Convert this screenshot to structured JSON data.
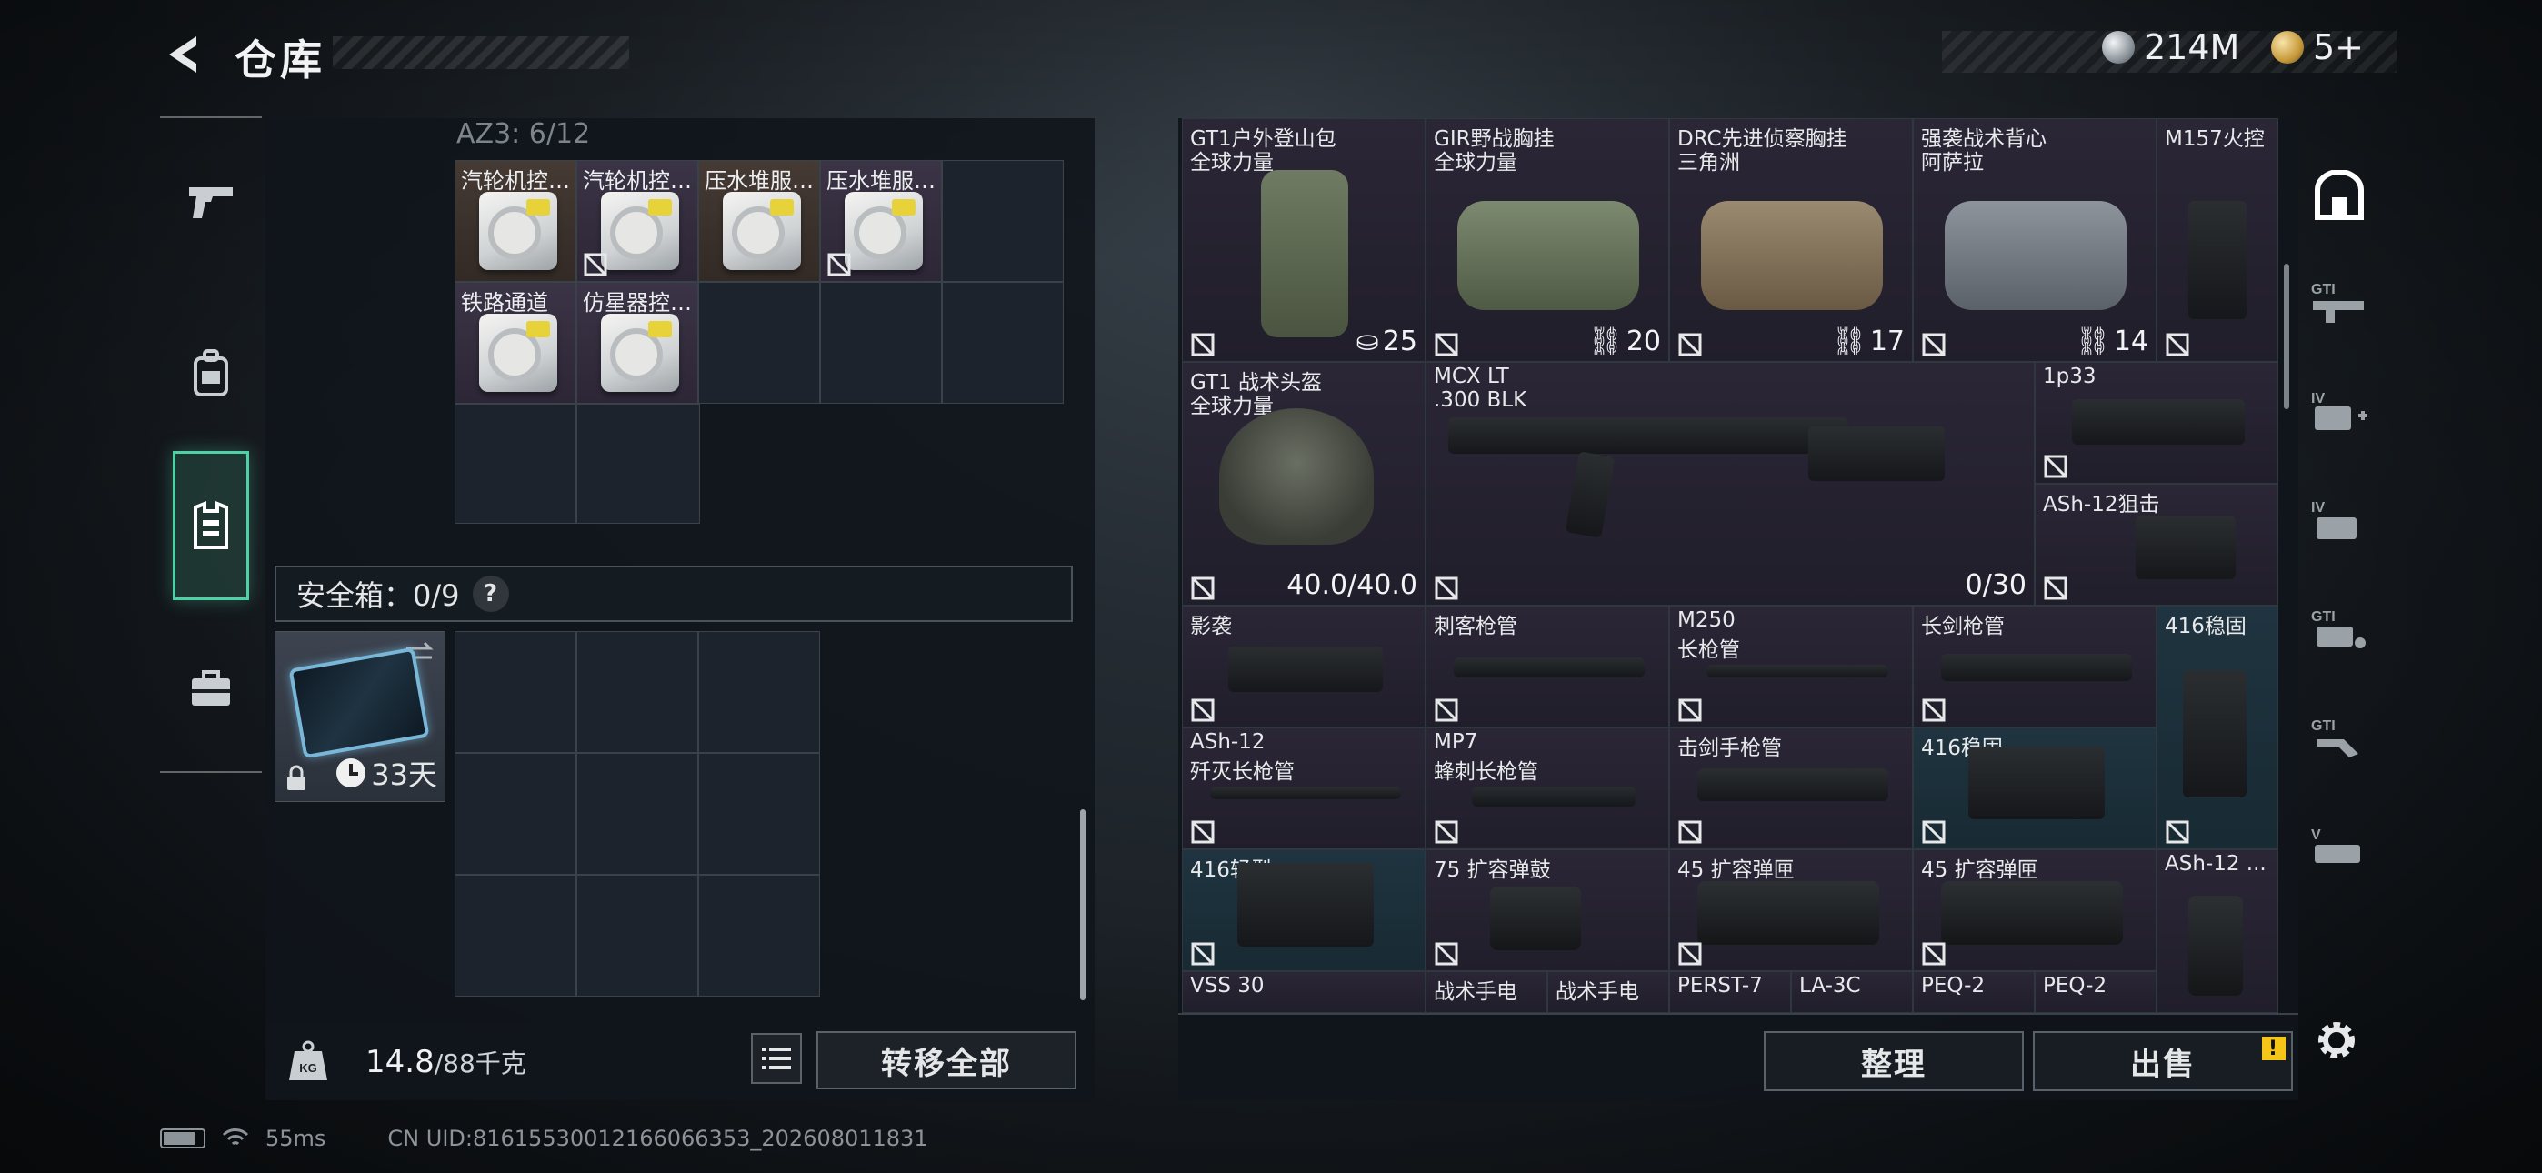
{
  "header": {
    "title": "仓库",
    "currency_silver": "214M",
    "currency_gold": "5+"
  },
  "left_rail": {
    "items": [
      {
        "name": "pistol-icon",
        "active": false
      },
      {
        "name": "backpack-icon",
        "active": false
      },
      {
        "name": "vest-icon",
        "active": true
      },
      {
        "name": "case-icon",
        "active": false
      }
    ]
  },
  "storage": {
    "section_label": "AZ3: 6/12",
    "items": [
      {
        "label": "汽轮机控…",
        "no_sell": false,
        "brown": true
      },
      {
        "label": "汽轮机控…",
        "no_sell": true,
        "brown": false
      },
      {
        "label": "压水堆服…",
        "no_sell": false,
        "brown": true
      },
      {
        "label": "压水堆服…",
        "no_sell": true,
        "brown": false
      },
      {
        "label": "铁路通道",
        "no_sell": false,
        "brown": false
      },
      {
        "label": "仿星器控…",
        "no_sell": false,
        "brown": false
      }
    ]
  },
  "safe_box": {
    "label": "安全箱：0/9",
    "help": "?",
    "days": "33天"
  },
  "weight": {
    "current": "14.8",
    "max": "/88千克"
  },
  "buttons": {
    "transfer_all": "转移全部",
    "organize": "整理",
    "sell": "出售",
    "sell_badge": "!"
  },
  "inventory": {
    "items": [
      {
        "n1": "GT1户外登山包",
        "n2": "全球力量",
        "stat": "25",
        "stat_icon": "capacity",
        "art": "bag-olive"
      },
      {
        "n1": "GIR野战胸挂",
        "n2": "全球力量",
        "stat": "20",
        "stat_icon": "durability",
        "art": "bag-green"
      },
      {
        "n1": "DRC先进侦察胸挂",
        "n2": "三角洲",
        "stat": "17",
        "stat_icon": "durability",
        "art": "bag-tan"
      },
      {
        "n1": "强袭战术背心",
        "n2": "阿萨拉",
        "stat": "14",
        "stat_icon": "durability",
        "art": "bag-grey"
      },
      {
        "n1": "M157火控",
        "n2": "",
        "stat": "",
        "art": "scope"
      },
      {
        "n1": "GT1 战术头盔",
        "n2": "全球力量",
        "stat": "40.0/40.0",
        "art": "helmet"
      },
      {
        "n1": "MCX LT",
        "n2": ".300 BLK",
        "stat": "0/30",
        "art": "rifle"
      },
      {
        "n1": "1p33",
        "n2": "",
        "stat": "",
        "art": "scope"
      },
      {
        "n1": "ASh-12狙击",
        "n2": "",
        "stat": "",
        "art": "stock"
      },
      {
        "n1": "影袭",
        "n2": "",
        "art": "stock"
      },
      {
        "n1": "刺客枪管",
        "n2": "",
        "art": "barrel"
      },
      {
        "n1": "M250",
        "n2": "长枪管",
        "art": "barrel"
      },
      {
        "n1": "长剑枪管",
        "n2": "",
        "art": "barrel"
      },
      {
        "n1": "416稳固",
        "n2": "",
        "art": "grip"
      },
      {
        "n1": "ASh-12",
        "n2": "歼灭长枪管",
        "art": "barrel"
      },
      {
        "n1": "MP7",
        "n2": "蜂刺长枪管",
        "art": "barrel"
      },
      {
        "n1": "击剑手枪管",
        "n2": "",
        "art": "barrel"
      },
      {
        "n1": "416稳固",
        "n2": "",
        "art": "stock"
      },
      {
        "n1": "416轻型",
        "n2": "",
        "art": "stock"
      },
      {
        "n1": "75 扩容弹鼓",
        "n2": "",
        "art": "drum"
      },
      {
        "n1": "45 扩容弹匣",
        "n2": "",
        "art": "mag"
      },
      {
        "n1": "45 扩容弹匣",
        "n2": "",
        "art": "mag"
      },
      {
        "n1": "ASh-12 ...",
        "n2": "",
        "art": "mag"
      },
      {
        "n1": "VSS 30",
        "n2": ""
      },
      {
        "n1": "战术手电",
        "n2": ""
      },
      {
        "n1": "战术手电",
        "n2": ""
      },
      {
        "n1": "PERST-7",
        "n2": ""
      },
      {
        "n1": "LA-3C",
        "n2": ""
      },
      {
        "n1": "PEQ-2",
        "n2": ""
      },
      {
        "n1": "PEQ-2",
        "n2": ""
      }
    ]
  },
  "right_rail": {
    "items": [
      "container-icon",
      "gti-rifle-icon",
      "iv-medkit-icon",
      "iv-ammo-icon",
      "gti-device-icon",
      "gti-tool-icon",
      "v-misc-icon"
    ]
  },
  "status": {
    "ping": "55ms",
    "uid": "CN UID:81615530012166066353_202608011831"
  },
  "colors": {
    "accent": "#4fd1a5",
    "warning": "#f5c518"
  }
}
